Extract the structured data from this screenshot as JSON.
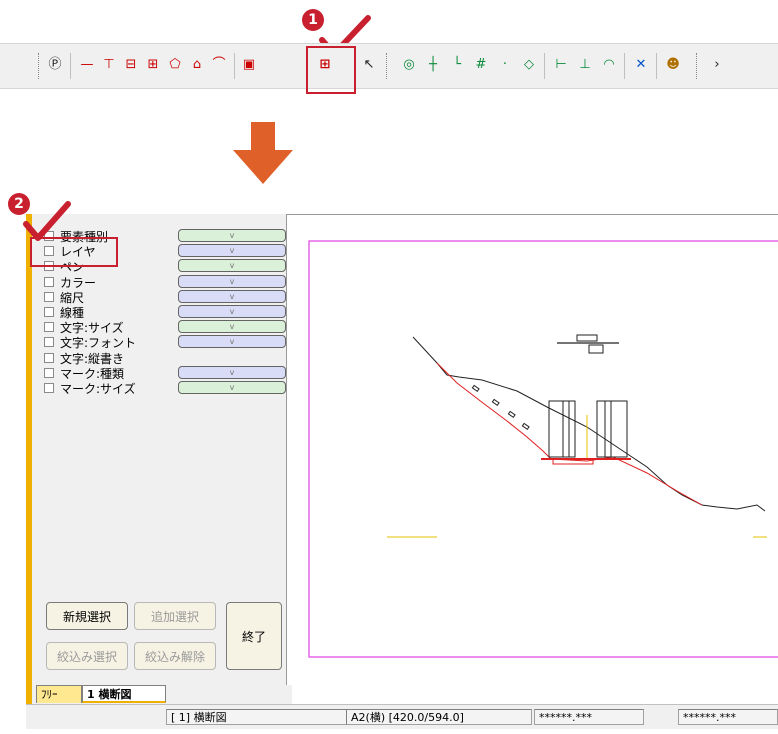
{
  "markers": {
    "one": "1",
    "two": "2"
  },
  "toolbar": {
    "icons": [
      {
        "name": "pen-icon",
        "glyph": "Ⓟ"
      },
      {
        "name": "line-icon",
        "glyph": "—"
      },
      {
        "name": "cross-line-icon",
        "glyph": "⊤"
      },
      {
        "name": "rectangle-icon",
        "glyph": "⊟"
      },
      {
        "name": "grid-rect-icon",
        "glyph": "⊞"
      },
      {
        "name": "pentagon-icon",
        "glyph": "⬠"
      },
      {
        "name": "house-icon",
        "glyph": "⌂"
      },
      {
        "name": "arc-icon",
        "glyph": "⌒"
      },
      {
        "name": "label-icon",
        "glyph": "▣"
      },
      {
        "name": "layer-select-icon",
        "glyph": "⊞"
      },
      {
        "name": "pointer-icon",
        "glyph": "↖"
      },
      {
        "name": "snap-circle-icon",
        "glyph": "◎"
      },
      {
        "name": "snap-cross-icon",
        "glyph": "┼"
      },
      {
        "name": "snap-corner-icon",
        "glyph": "└"
      },
      {
        "name": "snap-hash-icon",
        "glyph": "#"
      },
      {
        "name": "snap-point-icon",
        "glyph": "·"
      },
      {
        "name": "snap-diamond-icon",
        "glyph": "◇"
      },
      {
        "name": "snap-end-icon",
        "glyph": "⊢"
      },
      {
        "name": "snap-mid-icon",
        "glyph": "⊥"
      },
      {
        "name": "snap-arc-icon",
        "glyph": "◠"
      },
      {
        "name": "snap-x-icon",
        "glyph": "✕"
      },
      {
        "name": "snap-person-icon",
        "glyph": "☻"
      }
    ]
  },
  "panel": {
    "rows": [
      {
        "label": "要素種別",
        "drop": "green"
      },
      {
        "label": "レイヤ",
        "drop": "blue"
      },
      {
        "label": "ペン",
        "drop": "green"
      },
      {
        "label": "カラー",
        "drop": "blue"
      },
      {
        "label": "縮尺",
        "drop": "blue"
      },
      {
        "label": "線種",
        "drop": "blue"
      },
      {
        "label": "文字:サイズ",
        "drop": "green"
      },
      {
        "label": "文字:フォント",
        "drop": "blue"
      },
      {
        "label": "文字:縦書き",
        "drop": ""
      },
      {
        "label": "マーク:種類",
        "drop": "blue"
      },
      {
        "label": "マーク:サイズ",
        "drop": "green"
      }
    ],
    "drop_glyph": "v",
    "buttons": {
      "new_select": "新規選択",
      "add_select": "追加選択",
      "narrow_select": "絞込み選択",
      "narrow_clear": "絞込み解除",
      "finish": "終了"
    }
  },
  "tabs": {
    "free": "ﾌﾘｰ",
    "cross": "1 横断図"
  },
  "status": {
    "view": "[ 1] 横断図",
    "paper": "A2(横) [420.0/594.0]",
    "coord1": "******.***",
    "coord2": "******.***"
  },
  "colors": {
    "accent": "#c8202f",
    "arrow": "#e0602a",
    "frame": "#e040e0",
    "panel_border": "#f0b000"
  }
}
